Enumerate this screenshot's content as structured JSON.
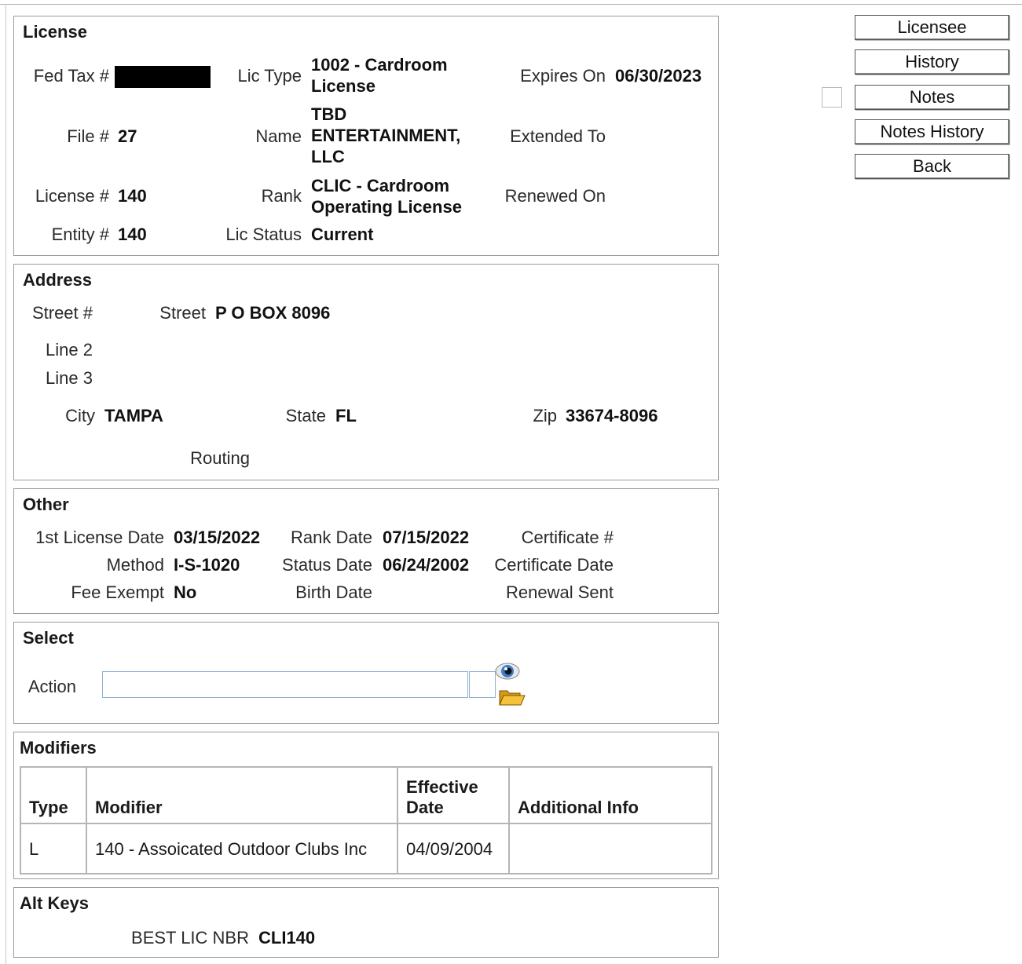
{
  "buttons": {
    "licensee": "Licensee",
    "history": "History",
    "notes": "Notes",
    "notes_history": "Notes History",
    "back": "Back"
  },
  "license": {
    "title": "License",
    "fed_tax_label": "Fed Tax #",
    "lic_type_label": "Lic Type",
    "lic_type_value": "1002 - Cardroom License",
    "expires_label": "Expires On",
    "expires_value": "06/30/2023",
    "file_label": "File #",
    "file_value": "27",
    "name_label": "Name",
    "name_value": "TBD ENTERTAINMENT, LLC",
    "extended_label": "Extended To",
    "license_no_label": "License #",
    "license_no_value": "140",
    "rank_label": "Rank",
    "rank_value": "CLIC - Cardroom Operating License",
    "renewed_label": "Renewed On",
    "entity_label": "Entity #",
    "entity_value": "140",
    "status_label": "Lic Status",
    "status_value": "Current"
  },
  "address": {
    "title": "Address",
    "street_no_label": "Street #",
    "street_label": "Street",
    "street_value": "P O BOX 8096",
    "line2_label": "Line 2",
    "line3_label": "Line 3",
    "city_label": "City",
    "city_value": "TAMPA",
    "state_label": "State",
    "state_value": "FL",
    "zip_label": "Zip",
    "zip_value": "33674-8096",
    "routing_label": "Routing"
  },
  "other": {
    "title": "Other",
    "first_license_label": "1st License Date",
    "first_license_value": "03/15/2022",
    "rank_date_label": "Rank Date",
    "rank_date_value": "07/15/2022",
    "certificate_label": "Certificate #",
    "method_label": "Method",
    "method_value": "I-S-1020",
    "status_date_label": "Status Date",
    "status_date_value": "06/24/2002",
    "certificate_date_label": "Certificate Date",
    "fee_exempt_label": "Fee Exempt",
    "fee_exempt_value": "No",
    "birth_date_label": "Birth Date",
    "renewal_sent_label": "Renewal Sent"
  },
  "select": {
    "title": "Select",
    "action_label": "Action",
    "action_value": "",
    "view_icon": "eye-icon",
    "open_icon": "folder-open-icon"
  },
  "modifiers": {
    "title": "Modifiers",
    "columns": [
      "Type",
      "Modifier",
      "Effective Date",
      "Additional Info"
    ],
    "rows": [
      [
        "L",
        "140 - Assoicated Outdoor Clubs Inc",
        "04/09/2004",
        ""
      ]
    ]
  },
  "alt_keys": {
    "title": "Alt Keys",
    "best_lic_label": "BEST LIC NBR",
    "best_lic_value": "CLI140"
  }
}
